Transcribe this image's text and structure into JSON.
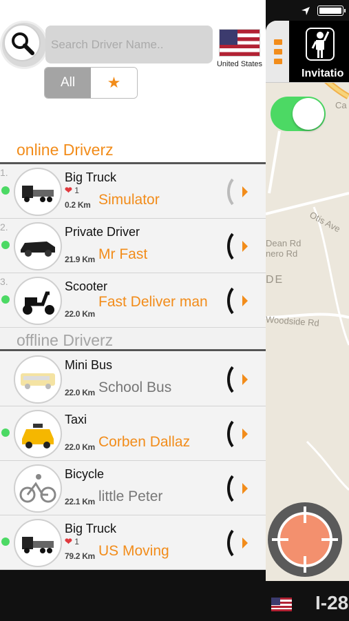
{
  "search": {
    "placeholder": "Search Driver Name.."
  },
  "country": {
    "label": "United States"
  },
  "filter": {
    "all_label": "All",
    "favorites_icon": "★"
  },
  "online": {
    "title": "online Driverz",
    "drivers": [
      {
        "num": "1.",
        "vehicle": "Big Truck",
        "likes": "1",
        "distance": "0.2 Km",
        "name": "Simulator",
        "icon": "truck-icon",
        "online": true
      },
      {
        "num": "2.",
        "vehicle": "Private Driver",
        "distance": "21.9 Km",
        "name": "Mr Fast",
        "icon": "car-icon",
        "online": true
      },
      {
        "num": "3.",
        "vehicle": "Scooter",
        "distance": "22.0 Km",
        "name": "Fast Deliver man",
        "icon": "scooter-icon",
        "online": true
      }
    ]
  },
  "offline": {
    "title": "offline Driverz",
    "drivers": [
      {
        "vehicle": "Mini Bus",
        "distance": "22.0 Km",
        "name": "School Bus",
        "icon": "bus-icon",
        "online": false
      },
      {
        "vehicle": "Taxi",
        "distance": "22.0 Km",
        "name": "Corben Dallaz",
        "icon": "taxi-icon",
        "online": true
      },
      {
        "vehicle": "Bicycle",
        "distance": "22.1 Km",
        "name": "little Peter",
        "icon": "bicycle-icon",
        "online": false
      },
      {
        "vehicle": "Big Truck",
        "likes": "1",
        "distance": "79.2 Km",
        "name": "US Moving",
        "icon": "truck-icon",
        "online": true
      }
    ]
  },
  "map": {
    "invite_label": "Invitatio",
    "street_labels": [
      "Ca",
      "Otis Ave",
      "Dean Rd",
      "nero Rd",
      "DE",
      "Woodside Rd"
    ],
    "bottom_label": "I-28"
  },
  "colors": {
    "accent": "#f28c1a",
    "online": "#4cd964",
    "gray_text": "#a4a4a4"
  }
}
